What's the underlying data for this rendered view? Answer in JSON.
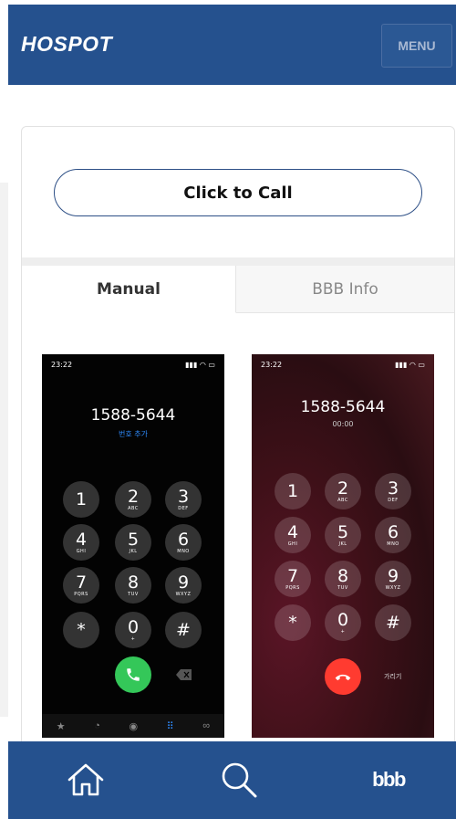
{
  "header": {
    "brand": "HOSPOT",
    "menu_label": "MENU"
  },
  "card": {
    "call_button": "Click to Call"
  },
  "tabs": [
    {
      "label": "Manual",
      "active": true
    },
    {
      "label": "BBB Info",
      "active": false
    }
  ],
  "phones": [
    {
      "time": "23:22",
      "number": "1588-5644",
      "subtext": "번호 추가",
      "subtext_color": "#2f8cff",
      "keys": [
        {
          "digit": "1",
          "letters": ""
        },
        {
          "digit": "2",
          "letters": "ABC"
        },
        {
          "digit": "3",
          "letters": "DEF"
        },
        {
          "digit": "4",
          "letters": "GHI"
        },
        {
          "digit": "5",
          "letters": "JKL"
        },
        {
          "digit": "6",
          "letters": "MNO"
        },
        {
          "digit": "7",
          "letters": "PQRS"
        },
        {
          "digit": "8",
          "letters": "TUV"
        },
        {
          "digit": "9",
          "letters": "WXYZ"
        },
        {
          "digit": "*",
          "letters": ""
        },
        {
          "digit": "0",
          "letters": "+"
        },
        {
          "digit": "#",
          "letters": ""
        }
      ],
      "call_color": "#34c759"
    },
    {
      "time": "23:22",
      "number": "1588-5644",
      "subtext": "00:00",
      "subtext_color": "#cccccc",
      "keys": [
        {
          "digit": "1",
          "letters": ""
        },
        {
          "digit": "2",
          "letters": "ABC"
        },
        {
          "digit": "3",
          "letters": "DEF"
        },
        {
          "digit": "4",
          "letters": "GHI"
        },
        {
          "digit": "5",
          "letters": "JKL"
        },
        {
          "digit": "6",
          "letters": "MNO"
        },
        {
          "digit": "7",
          "letters": "PQRS"
        },
        {
          "digit": "8",
          "letters": "TUV"
        },
        {
          "digit": "9",
          "letters": "WXYZ"
        },
        {
          "digit": "*",
          "letters": ""
        },
        {
          "digit": "0",
          "letters": "+"
        },
        {
          "digit": "#",
          "letters": ""
        }
      ],
      "side_label": "가리기",
      "call_color": "#ff3b30"
    }
  ],
  "bottom_nav": {
    "bbb_label": "bbb",
    "icons": [
      "home-icon",
      "search-icon"
    ]
  },
  "colors": {
    "brand_blue": "#25518e",
    "button_border": "#2d4f86"
  }
}
